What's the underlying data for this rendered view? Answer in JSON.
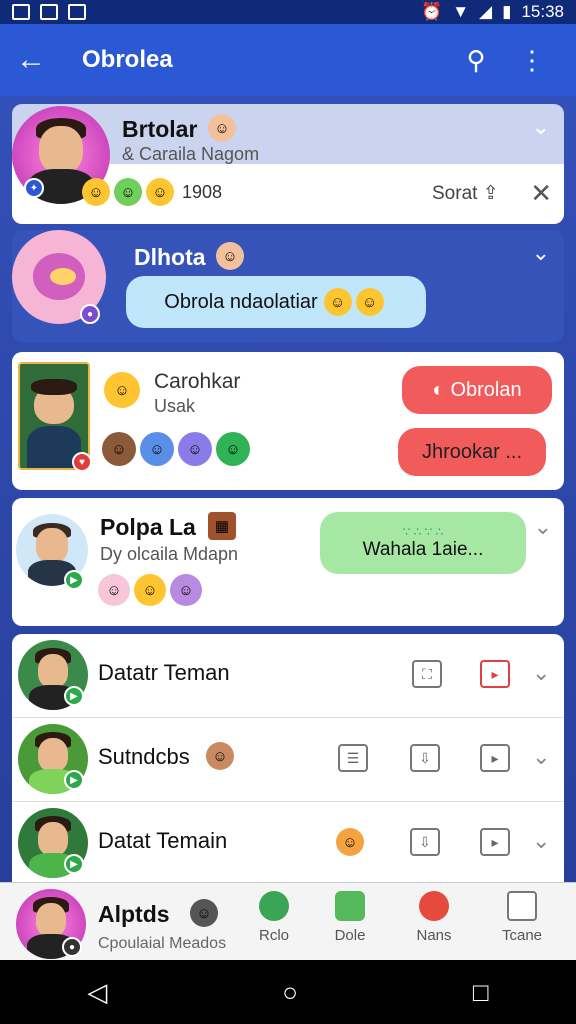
{
  "status_bar": {
    "time": "15:38"
  },
  "app_bar": {
    "title": "Obrolea",
    "back_icon": "arrow-left-icon",
    "search_icon": "search-icon",
    "menu_icon": "more-vert-icon"
  },
  "cards": [
    {
      "name": "Brtolar",
      "subtitle": "& Caraila Nagom",
      "count": "1908",
      "action": "Sorat"
    },
    {
      "name": "Dlhota",
      "message": "Obrola ndaolatiar"
    },
    {
      "name": "Carohkar",
      "subtitle": "Usak",
      "btn1": "Obrolan",
      "btn2": "Jhrookar ..."
    },
    {
      "name": "Polpa La",
      "subtitle": "Dy olcaila Mdapn",
      "message": "Wahala 1aie...",
      "dots": "∵ ∴ ∵ ∴"
    }
  ],
  "rows": [
    {
      "label": "Datatr Teman"
    },
    {
      "label": "Sutndcbs"
    },
    {
      "label": "Datat Temain"
    }
  ],
  "bottom_nav": {
    "profile_name": "Alptds",
    "profile_sub": "Cpoulaial Meados",
    "items": [
      "Rclo",
      "Dole",
      "Nans",
      "Tcane"
    ]
  },
  "colors": {
    "primary": "#2b59d6",
    "background": "#1a3d9e",
    "bubble_blue": "#bfe6fb",
    "bubble_green": "#a6e7a4",
    "bubble_red": "#f15b5b"
  }
}
